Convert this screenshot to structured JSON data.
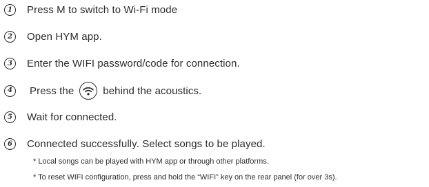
{
  "steps": [
    {
      "number": "1",
      "text": "Press M to switch to Wi-Fi mode"
    },
    {
      "number": "2",
      "text": "Open HYM app."
    },
    {
      "number": "3",
      "text": "Enter the WIFI password/code for connection."
    },
    {
      "number": "4",
      "text_before": "Press the",
      "icon": "wifi-icon",
      "text_after": "behind the acoustics."
    },
    {
      "number": "5",
      "text": "Wait for connected."
    },
    {
      "number": "6",
      "text": "Connected successfully. Select songs to be played."
    }
  ],
  "notes": [
    "* Local songs can be played with HYM app or through other platforms.",
    "* To reset WIFI configuration, press and hold the “WIFI” key on the rear panel (for over 3s)."
  ]
}
